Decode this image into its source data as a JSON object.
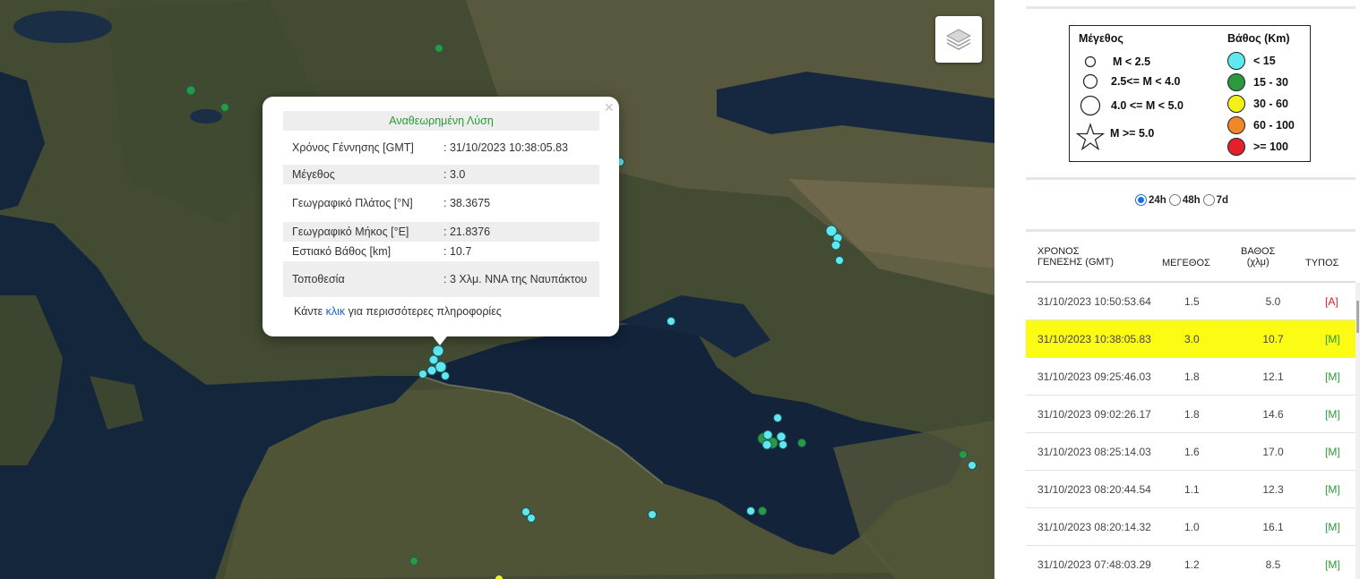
{
  "popup": {
    "title": "Αναθεωρημένη Λύση",
    "rows": [
      {
        "label": "Χρόνος Γέννησης [GMT]",
        "value": ": 31/10/2023 10:38:05.83"
      },
      {
        "label": "Μέγεθος",
        "value": ": 3.0"
      },
      {
        "label": "Γεωγραφικό Πλάτος [°N]",
        "value": ": 38.3675"
      },
      {
        "label": "Γεωγραφικό Μήκος [°E]",
        "value": ": 21.8376"
      },
      {
        "label": "Εστιακό Βάθος [km]",
        "value": ": 10.7"
      },
      {
        "label": "Τοποθεσία",
        "value": ": 3 Χλμ. ΝΝΑ της Ναυπάκτου"
      }
    ],
    "more_prefix": "Κάντε ",
    "more_link": "κλικ",
    "more_suffix": " για περισσότερες πληροφορίες",
    "close": "×"
  },
  "legend": {
    "magnitude_title": "Μέγεθος",
    "depth_title": "Βάθος (Km)",
    "magnitudes": [
      "M < 2.5",
      "2.5<= M < 4.0",
      "4.0 <= M < 5.0",
      "M >= 5.0"
    ],
    "depths": [
      {
        "label": "< 15",
        "color": "#5fe8ef"
      },
      {
        "label": "15 - 30",
        "color": "#2b9a3f"
      },
      {
        "label": "30 - 60",
        "color": "#f3ef19"
      },
      {
        "label": "60 - 100",
        "color": "#f2862a"
      },
      {
        "label": ">= 100",
        "color": "#e4202a"
      }
    ]
  },
  "timeframe": {
    "options": [
      "24h",
      "48h",
      "7d"
    ],
    "selected": "24h"
  },
  "table": {
    "headers": {
      "time": "ΧΡΟΝΟΣ\nΓΕΝΕΣΗΣ (GMT)",
      "time_l1": "ΧΡΟΝΟΣ",
      "time_l2": "ΓΕΝΕΣΗΣ (GMT)",
      "mag": "ΜΕΓΕΘΟΣ",
      "depth_l1": "ΒΑΘΟΣ",
      "depth_l2": "(χλμ)",
      "type": "ΤΥΠΟΣ"
    },
    "rows": [
      {
        "time": "31/10/2023 10:50:53.64",
        "mag": "1.5",
        "depth": "5.0",
        "type": "[A]",
        "selected": false
      },
      {
        "time": "31/10/2023 10:38:05.83",
        "mag": "3.0",
        "depth": "10.7",
        "type": "[M]",
        "selected": true
      },
      {
        "time": "31/10/2023 09:25:46.03",
        "mag": "1.8",
        "depth": "12.1",
        "type": "[M]",
        "selected": false
      },
      {
        "time": "31/10/2023 09:02:26.17",
        "mag": "1.8",
        "depth": "14.6",
        "type": "[M]",
        "selected": false
      },
      {
        "time": "31/10/2023 08:25:14.03",
        "mag": "1.6",
        "depth": "17.0",
        "type": "[M]",
        "selected": false
      },
      {
        "time": "31/10/2023 08:20:44.54",
        "mag": "1.1",
        "depth": "12.3",
        "type": "[M]",
        "selected": false
      },
      {
        "time": "31/10/2023 08:20:14.32",
        "mag": "1.0",
        "depth": "16.1",
        "type": "[M]",
        "selected": false
      },
      {
        "time": "31/10/2023 07:48:03.29",
        "mag": "1.2",
        "depth": "8.5",
        "type": "[M]",
        "selected": false
      }
    ]
  },
  "colors": {
    "shallow": "#5fe8ef",
    "mid": "#2b9a3f",
    "highlight": "#fbfb14",
    "link": "#1a64c8"
  }
}
